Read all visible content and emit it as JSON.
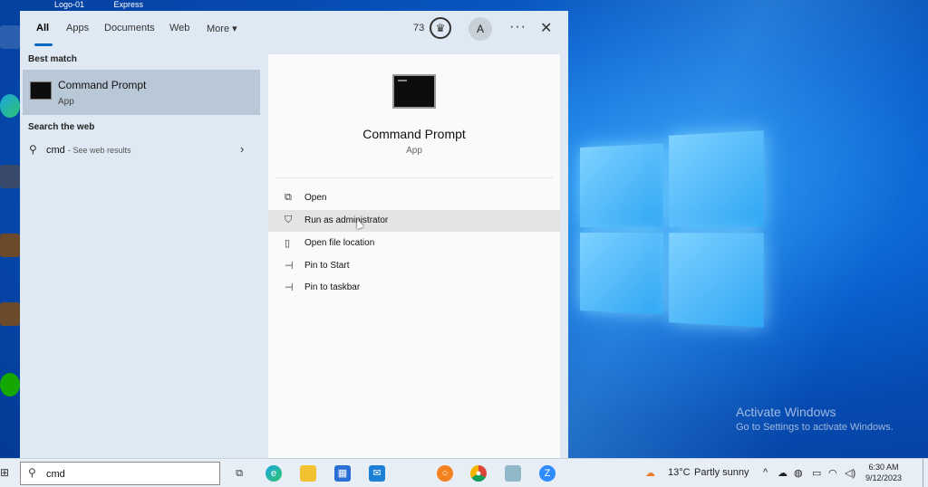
{
  "desktop": {
    "top_labels": [
      "Logo-01",
      "Express"
    ],
    "watermark": {
      "title": "Activate Windows",
      "subtitle": "Go to Settings to activate Windows."
    }
  },
  "search_panel": {
    "tabs": [
      {
        "label": "All",
        "active": true
      },
      {
        "label": "Apps"
      },
      {
        "label": "Documents"
      },
      {
        "label": "Web"
      },
      {
        "label": "More"
      }
    ],
    "points": "73",
    "avatar_initial": "A",
    "sections": {
      "best_match": "Best match",
      "search_web": "Search the web"
    },
    "best_match_item": {
      "title": "Command Prompt",
      "subtitle": "App"
    },
    "web_result": {
      "query": "cmd",
      "hint": "- See web results"
    },
    "detail": {
      "title": "Command Prompt",
      "subtitle": "App",
      "actions": [
        {
          "label": "Open",
          "icon": "open-icon"
        },
        {
          "label": "Run as administrator",
          "icon": "shield-icon",
          "hovered": true
        },
        {
          "label": "Open file location",
          "icon": "folder-icon"
        },
        {
          "label": "Pin to Start",
          "icon": "pin-icon"
        },
        {
          "label": "Pin to taskbar",
          "icon": "pin-icon"
        }
      ]
    }
  },
  "taskbar": {
    "search_value": "cmd",
    "weather": {
      "temp": "13°C",
      "condition": "Partly sunny"
    },
    "clock": {
      "time": "6:30 AM",
      "date": "9/12/2023"
    }
  }
}
